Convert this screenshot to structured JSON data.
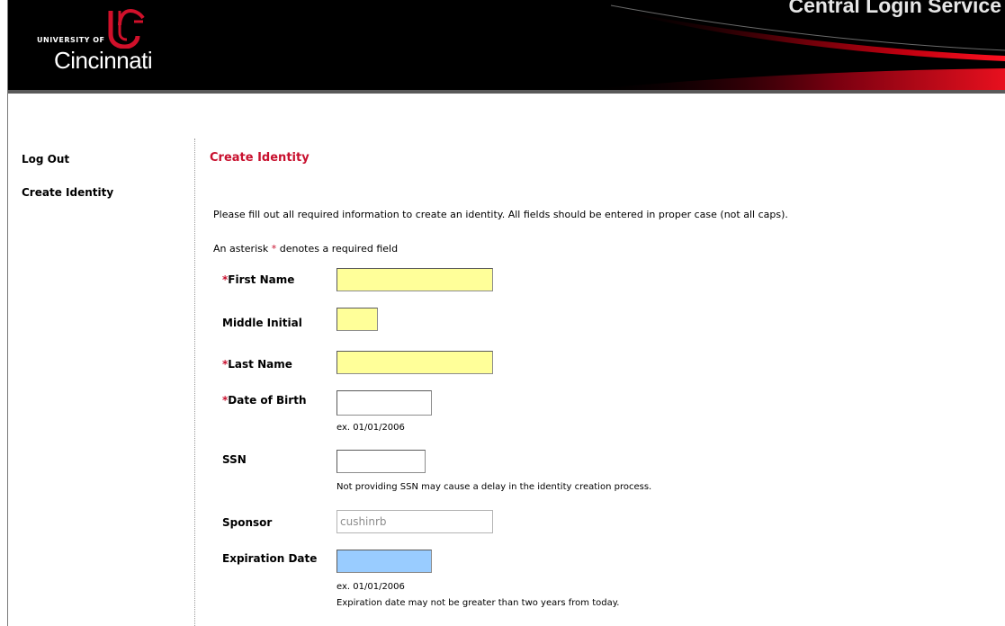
{
  "header": {
    "logo_top": "UNIVERSITY OF",
    "logo_name": "Cincinnati",
    "service_title": "Central Login Service"
  },
  "sidebar": {
    "items": [
      {
        "label": "Log Out"
      },
      {
        "label": "Create Identity"
      }
    ]
  },
  "main": {
    "title": "Create Identity",
    "intro": "Please fill out all required information to create an identity. All fields should be entered in proper case (not all caps).",
    "asterisk_note_prefix": "An asterisk ",
    "asterisk": "*",
    "asterisk_note_suffix": " denotes a required field",
    "fields": {
      "first_name": {
        "required_mark": "*",
        "label": "First Name",
        "value": ""
      },
      "middle_initial": {
        "label": "Middle Initial",
        "value": ""
      },
      "last_name": {
        "required_mark": "*",
        "label": "Last Name",
        "value": ""
      },
      "dob": {
        "required_mark": "*",
        "label": "Date of Birth",
        "value": "",
        "hint": "ex. 01/01/2006"
      },
      "ssn": {
        "label": "SSN",
        "value": "",
        "hint": "Not providing SSN may cause a delay in the identity creation process."
      },
      "sponsor": {
        "label": "Sponsor",
        "value": "cushinrb"
      },
      "expiration": {
        "label": "Expiration Date",
        "value": "",
        "hint": "ex. 01/01/2006",
        "note": "Expiration date may not be greater than two years from today."
      }
    }
  },
  "colors": {
    "accent_red": "#c8102e",
    "required_field": "#ffff99",
    "focused_field": "#99ccff"
  }
}
